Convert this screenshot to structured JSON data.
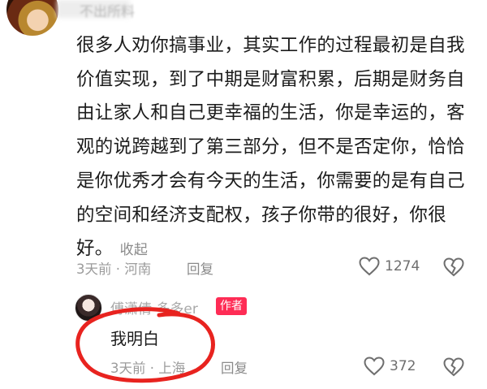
{
  "comment": {
    "author": "不出所料",
    "text": "很多人劝你搞事业，其实工作的过程最初是自我价值实现，到了中期是财富积累，后期是财务自由让家人和自己更幸福的生活，你是幸运的，客观的说跨越到了第三部分，但不是否定你，恰恰是你优秀才会有今天的生活，你需要的是有自己的空间和经济支配权，孩子你带的很好，你很好。",
    "collapse_label": "收起",
    "time": "3天前",
    "location": "河南",
    "reply_label": "回复",
    "likes": "1274",
    "like_icon": "heart-outline-icon",
    "dislike_icon": "broken-heart-icon"
  },
  "reply": {
    "author": "傅潇倩 多多er",
    "badge": "作者",
    "text": "我明白",
    "time": "3天前",
    "location": "上海",
    "reply_label": "回复",
    "likes": "372"
  },
  "colors": {
    "badge": "#fe2c55",
    "annotation": "#e8231f",
    "meta_text": "#9b9b9b"
  }
}
